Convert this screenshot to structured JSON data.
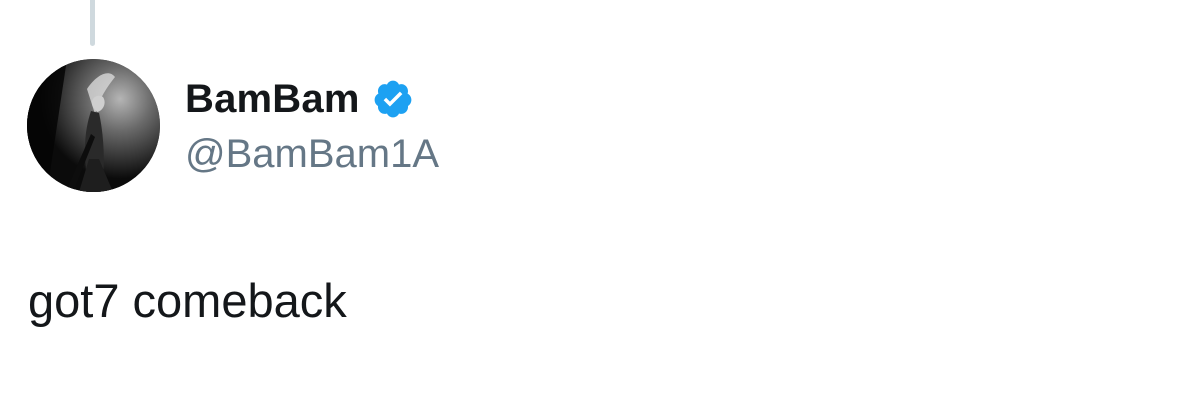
{
  "tweet": {
    "author": {
      "display_name": "BamBam",
      "handle": "@BamBam1A",
      "verified": true,
      "avatar": "avatar-image"
    },
    "text": "got7 comeback"
  },
  "colors": {
    "thread_line": "#cfd9de",
    "verified_badge": "#1da1f2",
    "name": "#14171a",
    "handle": "#657786",
    "text": "#14171a"
  },
  "icons": {
    "verified": "verified-badge-icon"
  }
}
